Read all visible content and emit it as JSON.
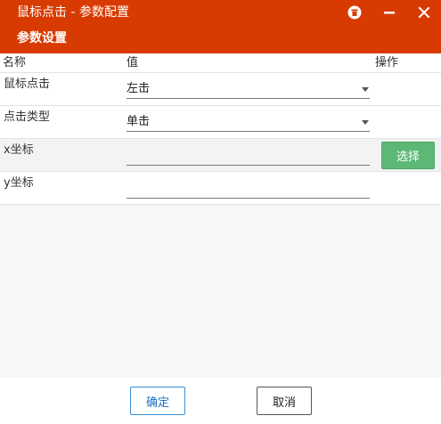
{
  "window": {
    "title": "鼠标点击 - 参数配置",
    "subtitle": "参数设置",
    "accent_color": "#d83b01",
    "controls": {
      "pin_icon": "pin-icon",
      "minimize_icon": "minimize-icon",
      "close_icon": "close-icon"
    }
  },
  "table": {
    "headers": {
      "name": "名称",
      "value": "值",
      "action": "操作"
    },
    "rows": [
      {
        "label": "鼠标点击",
        "type": "select",
        "value": "左击"
      },
      {
        "label": "点击类型",
        "type": "select",
        "value": "单击"
      },
      {
        "label": "x坐标",
        "type": "input",
        "value": "",
        "action_label": "选择"
      },
      {
        "label": "y坐标",
        "type": "input",
        "value": ""
      }
    ]
  },
  "footer": {
    "ok_label": "确定",
    "cancel_label": "取消"
  },
  "colors": {
    "choose_button": "#5cb874",
    "ok_border": "#3a8fd6"
  }
}
